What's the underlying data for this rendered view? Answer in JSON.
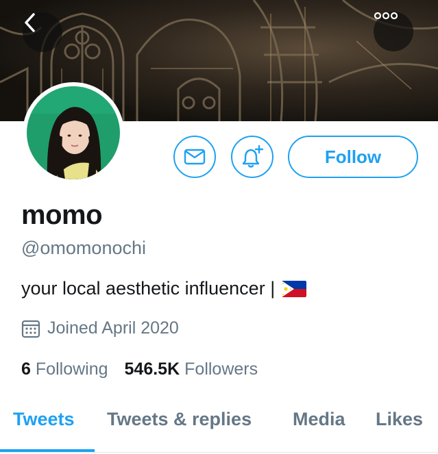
{
  "colors": {
    "accent": "#1da1f2",
    "secondary_text": "#657786",
    "primary_text": "#14171a"
  },
  "header": {
    "back_icon": "chevron-left-icon",
    "more_icon": "ellipsis-icon"
  },
  "actions": {
    "message_icon": "envelope-icon",
    "notify_icon": "bell-plus-icon",
    "follow_label": "Follow"
  },
  "profile": {
    "name": "momo",
    "handle": "@omomonochi",
    "bio": "your local aesthetic influencer |",
    "bio_flag": "philippines-flag-icon",
    "joined": "Joined April 2020"
  },
  "stats": {
    "following_count": "6",
    "following_label": "Following",
    "followers_count": "546.5K",
    "followers_label": "Followers"
  },
  "tabs": [
    {
      "label": "Tweets",
      "active": true
    },
    {
      "label": "Tweets & replies",
      "active": false
    },
    {
      "label": "Media",
      "active": false
    },
    {
      "label": "Likes",
      "active": false
    }
  ]
}
